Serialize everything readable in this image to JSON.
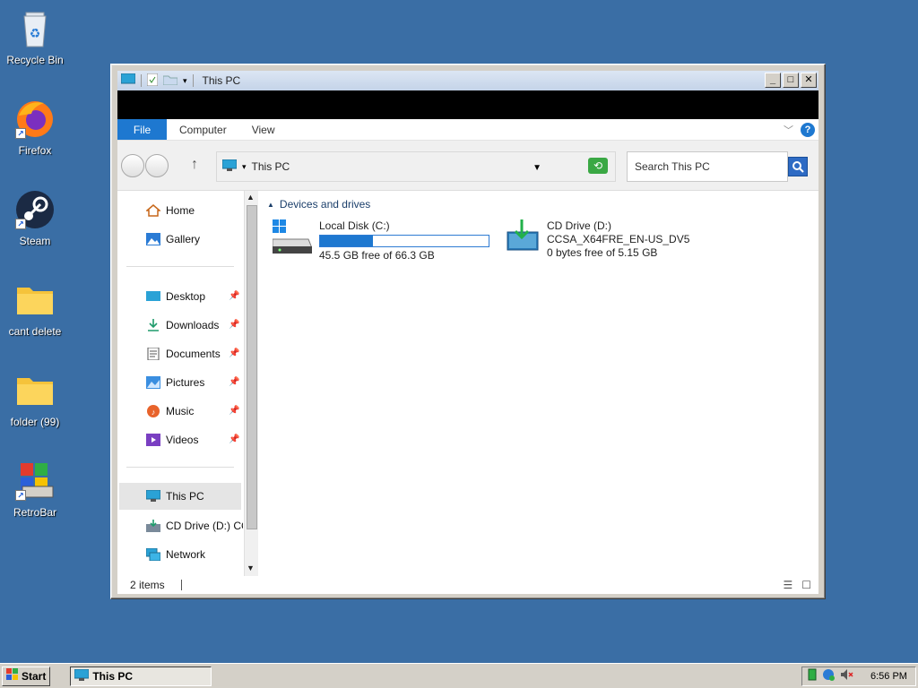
{
  "desktop": {
    "icons": [
      {
        "label": "Recycle Bin",
        "icon": "recycle-bin-icon"
      },
      {
        "label": "Firefox",
        "icon": "firefox-icon"
      },
      {
        "label": "Steam",
        "icon": "steam-icon"
      },
      {
        "label": "cant delete",
        "icon": "folder-icon"
      },
      {
        "label": "folder (99)",
        "icon": "folder-icon"
      },
      {
        "label": "RetroBar",
        "icon": "retrobar-icon"
      }
    ]
  },
  "window": {
    "title": "This PC",
    "ribbon_tabs": [
      "File",
      "Computer",
      "View"
    ],
    "address": "This PC",
    "search_placeholder": "Search This PC",
    "nav": {
      "home": "Home",
      "gallery": "Gallery",
      "desktop": "Desktop",
      "downloads": "Downloads",
      "documents": "Documents",
      "pictures": "Pictures",
      "music": "Music",
      "videos": "Videos",
      "this_pc": "This PC",
      "cd_drive": "CD Drive (D:) CC",
      "network": "Network"
    },
    "group_label": "Devices and drives",
    "drives": [
      {
        "name": "Local Disk (C:)",
        "free": "45.5 GB free of 66.3 GB",
        "used_fraction": 0.314
      },
      {
        "name": "CD Drive (D:)",
        "label": "CCSA_X64FRE_EN-US_DV5",
        "free": "0 bytes free of 5.15 GB"
      }
    ],
    "status_count": "2 items"
  },
  "taskbar": {
    "start": "Start",
    "task": "This PC",
    "clock": "6:56 PM"
  },
  "colors": {
    "desktop": "#3a6ea5",
    "accent": "#1e78d0"
  }
}
